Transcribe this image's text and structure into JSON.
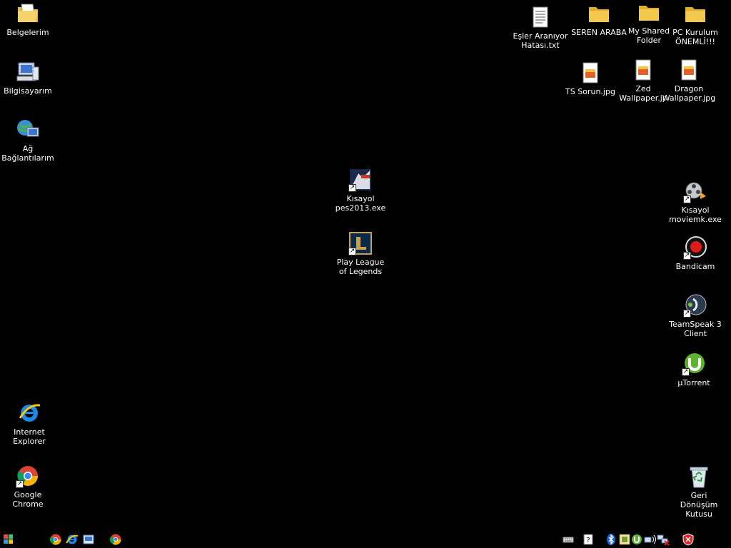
{
  "desktop": {
    "left_icons": [
      {
        "label": "Belgelerim",
        "icon": "my-documents-folder-icon"
      },
      {
        "label": "Bilgisayarım",
        "icon": "my-computer-icon"
      },
      {
        "label": "Ağ Bağlantılarım",
        "icon": "network-connections-icon"
      },
      {
        "label": "Internet Explorer",
        "icon": "internet-explorer-icon"
      },
      {
        "label": "Google Chrome",
        "icon": "google-chrome-icon"
      }
    ],
    "center_icons": [
      {
        "label": "Kısayol pes2013.exe",
        "icon": "pes2013-icon"
      },
      {
        "label": "Play League of Legends",
        "icon": "league-of-legends-icon"
      }
    ],
    "top_right_icons": [
      {
        "label": "Eşler Aranıyor Hatası.txt",
        "icon": "text-file-icon"
      },
      {
        "label": "SEREN ARABA",
        "icon": "folder-icon"
      },
      {
        "label": "My Shared Folder",
        "icon": "shared-folder-icon"
      },
      {
        "label": "PC Kurulum ÖNEMLİ!!!",
        "icon": "folder-icon"
      },
      {
        "label": "TS Sorun.jpg",
        "icon": "image-file-icon"
      },
      {
        "label": "Zed Wallpaper.jp",
        "icon": "image-file-icon"
      },
      {
        "label": "Dragon Wallpaper.jpg",
        "icon": "image-file-icon"
      }
    ],
    "right_icons": [
      {
        "label": "Kısayol moviemk.exe",
        "icon": "movie-maker-icon"
      },
      {
        "label": "Bandicam",
        "icon": "bandicam-icon"
      },
      {
        "label": "TeamSpeak 3 Client",
        "icon": "teamspeak-icon"
      },
      {
        "label": "µTorrent",
        "icon": "utorrent-icon"
      },
      {
        "label": "Geri Dönüşüm Kutusu",
        "icon": "recycle-bin-icon"
      }
    ]
  },
  "taskbar": {
    "start": "windows-start-icon",
    "quick_launch": [
      "chrome-icon",
      "internet-explorer-icon",
      "show-desktop-icon",
      "chrome-icon"
    ],
    "tray": [
      "keyboard-icon",
      "help-icon",
      "bluetooth-icon",
      "tray-app-icon",
      "utorrent-tray-icon",
      "network-icon",
      "network-disconnected-icon",
      "security-shield-icon"
    ]
  },
  "colors": {
    "background": "#000000",
    "label_text": "#ffffff",
    "folder_yellow": "#f2c94c"
  }
}
